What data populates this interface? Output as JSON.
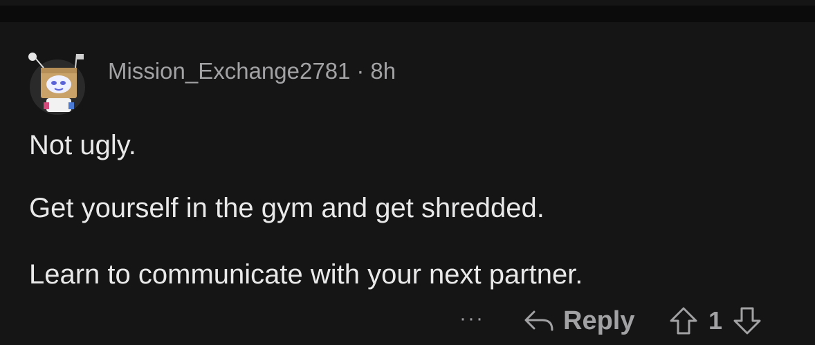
{
  "comment": {
    "username": "Mission_Exchange2781",
    "separator": "·",
    "age": "8h",
    "paragraphs": [
      "Not ugly.",
      "Get yourself in the gym and get shredded.",
      "Learn to communicate with your next partner."
    ]
  },
  "actions": {
    "more_label": "···",
    "reply_label": "Reply",
    "vote_count": "1"
  },
  "icons": {
    "avatar": "robot-box-avatar-icon",
    "reply": "reply-arrow-icon",
    "upvote": "upvote-arrow-icon",
    "downvote": "downvote-arrow-icon"
  },
  "colors": {
    "background": "#151515",
    "text": "#e9e9ea",
    "muted": "#a2a2a5"
  }
}
